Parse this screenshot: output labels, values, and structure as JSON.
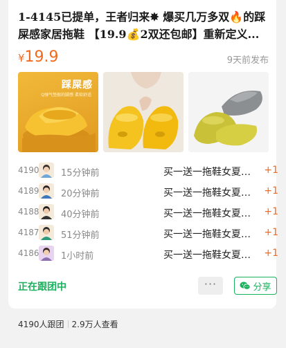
{
  "product": {
    "title": "1-4145已提单，王者归来✸ 爆买几万多双🔥的踩屎感家居拖鞋 【19.9💰2双还包邮】重新定义...",
    "currency": "¥",
    "price": "19.9",
    "posted": "9天前发布"
  },
  "images": [
    {
      "name": "yellow-slippers-promo",
      "text": "踩屎感",
      "subtext": "Q弹气垫般的脚感 柔软舒适"
    },
    {
      "name": "yellow-slippers-hand",
      "text": ""
    },
    {
      "name": "gray-yellow-slippers",
      "text": ""
    }
  ],
  "feed": [
    {
      "num": "4190",
      "time": "15分钟前",
      "item": "买一送一拖鞋女夏季室内...",
      "qty": "+1"
    },
    {
      "num": "4189",
      "time": "20分钟前",
      "item": "买一送一拖鞋女夏季室内...",
      "qty": "+1"
    },
    {
      "num": "4188",
      "time": "40分钟前",
      "item": "买一送一拖鞋女夏季室内...",
      "qty": "+1"
    },
    {
      "num": "4187",
      "time": "51分钟前",
      "item": "买一送一拖鞋女夏季室内...",
      "qty": "+1"
    },
    {
      "num": "4186",
      "time": "1小时前",
      "item": "买一送一拖鞋女夏季室内...",
      "qty": "+1"
    }
  ],
  "actions": {
    "status": "正在跟团中",
    "more": "···",
    "share": "分享"
  },
  "footer": {
    "followers": "4190人跟团",
    "views": "2.9万人查看"
  },
  "colors": {
    "accent": "#f06a1f",
    "green": "#19b25c"
  }
}
